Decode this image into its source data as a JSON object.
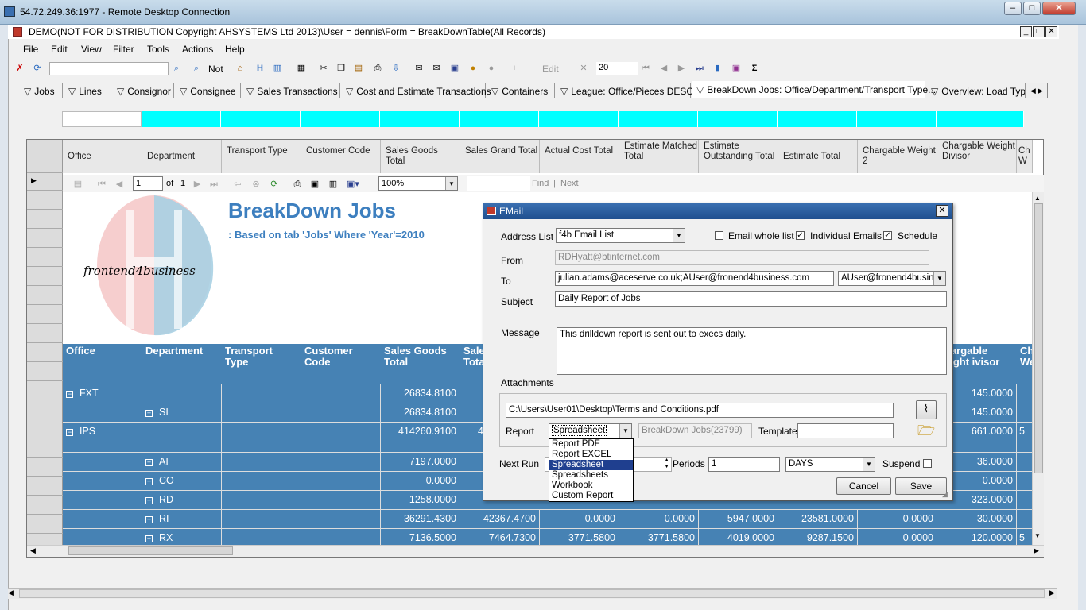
{
  "outer_window": {
    "title": "54.72.249.36:1977 - Remote Desktop Connection"
  },
  "app": {
    "title": "DEMO(NOT FOR DISTRIBUTION Copyright AHSYSTEMS Ltd 2013)\\User = dennis\\Form = BreakDownTable(All Records)"
  },
  "menu": [
    "File",
    "Edit",
    "View",
    "Filter",
    "Tools",
    "Actions",
    "Help"
  ],
  "toolbar": {
    "not_label": "Not",
    "edit_label": "Edit",
    "count": "20"
  },
  "tabs": [
    "Jobs",
    "Lines",
    "Consignor",
    "Consignee",
    "Sales Transactions",
    "Cost and Estimate Transactions",
    "Containers",
    "League: Office/Pieces DESC",
    "BreakDown Jobs: Office/Department/Transport Type...",
    "Overview: Load Typ"
  ],
  "grid_headers": [
    "Office",
    "Department",
    "Transport Type",
    "Customer Code",
    "Sales Goods Total",
    "Sales Grand Total",
    "Actual Cost Total",
    "Estimate Matched Total",
    "Estimate Outstanding Total",
    "Estimate Total",
    "Chargable Weight 2",
    "Chargable Weight Divisor",
    "Ch W"
  ],
  "report_toolbar": {
    "page": "1",
    "of_label": "of",
    "total_pages": "1",
    "zoom": "100%",
    "find_label": "Find",
    "next_label": "Next"
  },
  "report": {
    "title": "BreakDown Jobs",
    "subtitle": ": Based on tab 'Jobs' Where 'Year'=2010",
    "logo_text": "frontend4business",
    "headers": [
      "Office",
      "Department",
      "Transport Type",
      "Customer Code",
      "Sales Goods Total",
      "Sale Tota",
      "",
      "",
      "",
      "",
      "",
      "hargable eight ivisor",
      "Ch We"
    ],
    "rows": [
      {
        "expander": "−",
        "office": "FXT",
        "dept": "",
        "sales_goods": "26834.8100",
        "sales_grand": "",
        "actual": "",
        "matched": "",
        "outstanding": "",
        "estimate": "",
        "cw2": "",
        "divisor": "145.0000",
        "ch": ""
      },
      {
        "expander": "+",
        "office": "",
        "dept": "SI",
        "sales_goods": "26834.8100",
        "sales_grand": "",
        "actual": "",
        "matched": "",
        "outstanding": "",
        "estimate": "",
        "cw2": "",
        "divisor": "145.0000",
        "ch": ""
      },
      {
        "expander": "−",
        "office": "IPS",
        "dept": "",
        "sales_goods": "414260.9100",
        "sales_grand": "4",
        "actual": "",
        "matched": "",
        "outstanding": "",
        "estimate": "",
        "cw2": "",
        "divisor": "661.0000",
        "ch": "5"
      },
      {
        "expander": "+",
        "office": "",
        "dept": "AI",
        "sales_goods": "7197.0000",
        "sales_grand": "",
        "actual": "",
        "matched": "",
        "outstanding": "",
        "estimate": "",
        "cw2": "",
        "divisor": "36.0000",
        "ch": ""
      },
      {
        "expander": "+",
        "office": "",
        "dept": "CO",
        "sales_goods": "0.0000",
        "sales_grand": "",
        "actual": "",
        "matched": "",
        "outstanding": "",
        "estimate": "",
        "cw2": "",
        "divisor": "0.0000",
        "ch": ""
      },
      {
        "expander": "+",
        "office": "",
        "dept": "RD",
        "sales_goods": "1258.0000",
        "sales_grand": "",
        "actual": "",
        "matched": "",
        "outstanding": "",
        "estimate": "",
        "cw2": "",
        "divisor": "323.0000",
        "ch": ""
      },
      {
        "expander": "+",
        "office": "",
        "dept": "RI",
        "sales_goods": "36291.4300",
        "sales_grand": "42367.4700",
        "actual": "0.0000",
        "matched": "0.0000",
        "outstanding": "5947.0000",
        "estimate": "23581.0000",
        "cw2": "0.0000",
        "divisor": "30.0000",
        "ch": ""
      },
      {
        "expander": "+",
        "office": "",
        "dept": "RX",
        "sales_goods": "7136.5000",
        "sales_grand": "7464.7300",
        "actual": "3771.5800",
        "matched": "3771.5800",
        "outstanding": "4019.0000",
        "estimate": "9287.1500",
        "cw2": "0.0000",
        "divisor": "120.0000",
        "ch": "5"
      }
    ]
  },
  "email_dialog": {
    "title": "EMail",
    "address_list_label": "Address List",
    "address_list_value": "f4b Email List",
    "email_whole_list_label": "Email whole list",
    "individual_emails_label": "Individual Emails",
    "schedule_label": "Schedule",
    "from_label": "From",
    "from_value": "RDHyatt@btinternet.com",
    "to_label": "To",
    "to_value": "julian.adams@aceserve.co.uk;AUser@fronend4business.com",
    "to_select": "AUser@fronend4busine:",
    "subject_label": "Subject",
    "subject_value": "Daily Report of Jobs",
    "message_label": "Message",
    "message_value": "This drilldown report is sent out to execs daily.",
    "attachments_label": "Attachments",
    "attachment_path": "C:\\Users\\User01\\Desktop\\Terms and Conditions.pdf",
    "report_label": "Report",
    "report_select": "Spreadsheet",
    "report_name": "BreakDown Jobs(23799)",
    "template_label": "Template",
    "report_options": [
      "Report PDF",
      "Report EXCEL",
      "Spreadsheet",
      "Spreadsheets",
      "Workbook",
      "Custom Report"
    ],
    "next_run_label": "Next Run",
    "periods_label": "Periods",
    "periods_value": "1",
    "period_unit": "DAYS",
    "suspend_label": "Suspend",
    "cancel_label": "Cancel",
    "save_label": "Save"
  }
}
